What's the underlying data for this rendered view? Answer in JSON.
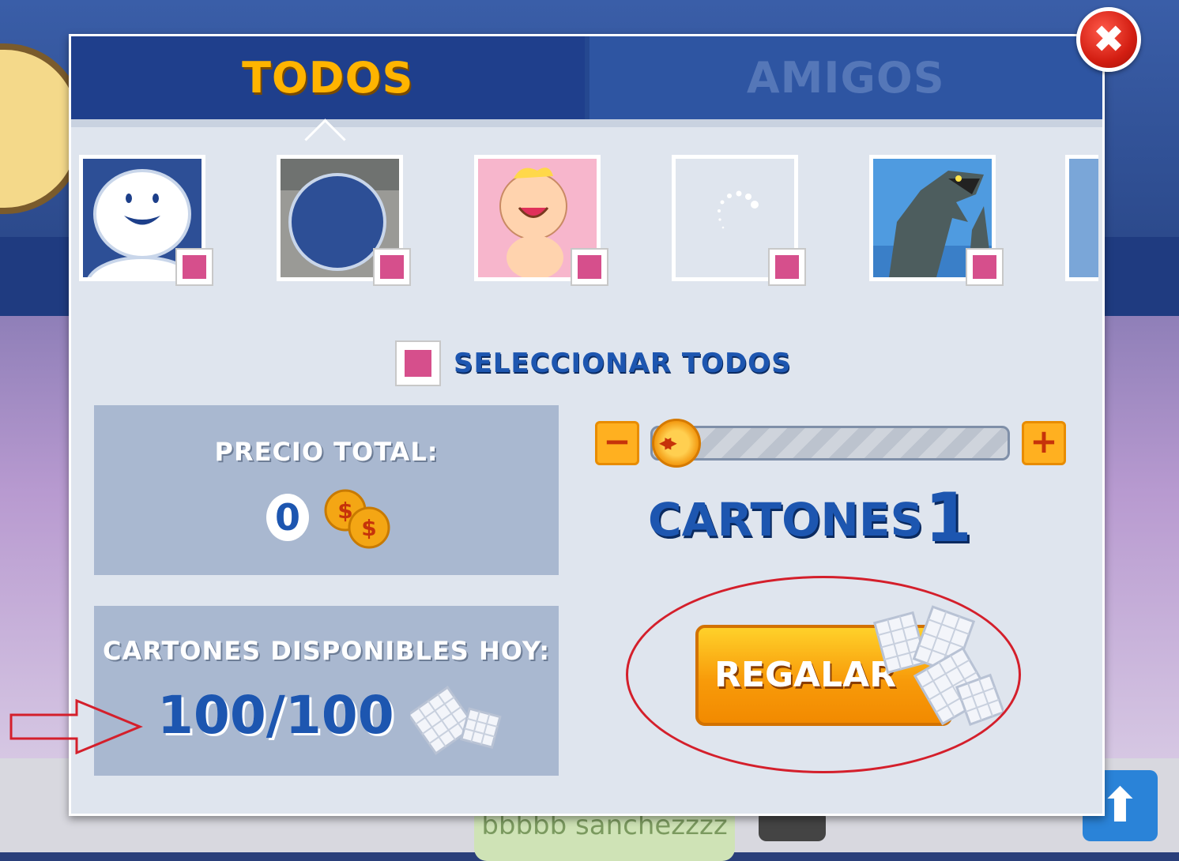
{
  "tabs": [
    {
      "label": "TODOS",
      "active": true
    },
    {
      "label": "AMIGOS",
      "active": false
    }
  ],
  "close_icon": "✖",
  "select_all": {
    "label": "SELECCIONAR TODOS"
  },
  "price": {
    "title": "PRECIO TOTAL:",
    "value": "0"
  },
  "available": {
    "title": "CARTONES DISPONIBLES HOY:",
    "value": "100/100"
  },
  "slider": {
    "minus": "−",
    "plus": "+",
    "value": 1
  },
  "cartones": {
    "label": "CARTONES",
    "count": "1"
  },
  "gift_button": {
    "label": "REGALAR"
  },
  "background": {
    "player_name": "bbbbb sanchezzzz"
  },
  "colors": {
    "accent": "#ffb400",
    "brand_blue": "#1d56b0",
    "checkbox": "#d64f8c",
    "highlight": "#d41f2b"
  }
}
